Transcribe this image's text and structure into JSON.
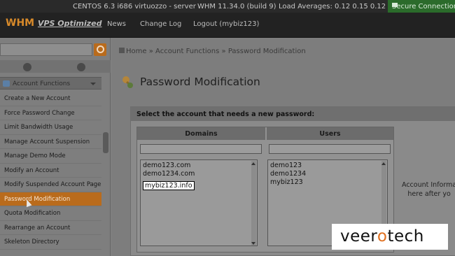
{
  "topbar": {
    "os": "CENTOS 6.3 i686 virtuozzo - server",
    "whm": "WHM 11.34.0 (build 9)",
    "load": "Load Averages: 0.12 0.15 0.12",
    "secure": "Secure Connection",
    "icon": "lock-icon"
  },
  "nav": {
    "logo_main": "WHM",
    "logo_sub": "VPS Optimized",
    "links": [
      "News",
      "Change Log",
      "Logout (mybiz123)"
    ]
  },
  "sidebar": {
    "search_value": "",
    "section": "Account Functions",
    "items": [
      "Create a New Account",
      "Force Password Change",
      "Limit Bandwidth Usage",
      "Manage Account Suspension",
      "Manage Demo Mode",
      "Modify an Account",
      "Modify Suspended Account Page",
      "Password Modification",
      "Quota Modification",
      "Rearrange an Account",
      "Skeleton Directory"
    ],
    "active_index": 7
  },
  "breadcrumb": {
    "home": "Home",
    "sep": "»",
    "section": "Account Functions",
    "current": "Password Modification"
  },
  "page": {
    "title": "Password Modification",
    "panel_heading": "Select the account that needs a new password:",
    "domains_header": "Domains",
    "users_header": "Users",
    "domains": [
      "demo123.com",
      "demo1234.com",
      "mybiz123.info"
    ],
    "users": [
      "demo123",
      "demo1234",
      "mybiz123"
    ],
    "info_line1": "Account Informa",
    "info_line2": "here after yo"
  },
  "watermark": {
    "part1": "veer",
    "o": "o",
    "part2": "tech"
  },
  "colors": {
    "accent": "#b96b1c",
    "secure_bg": "#2b6b2b"
  }
}
